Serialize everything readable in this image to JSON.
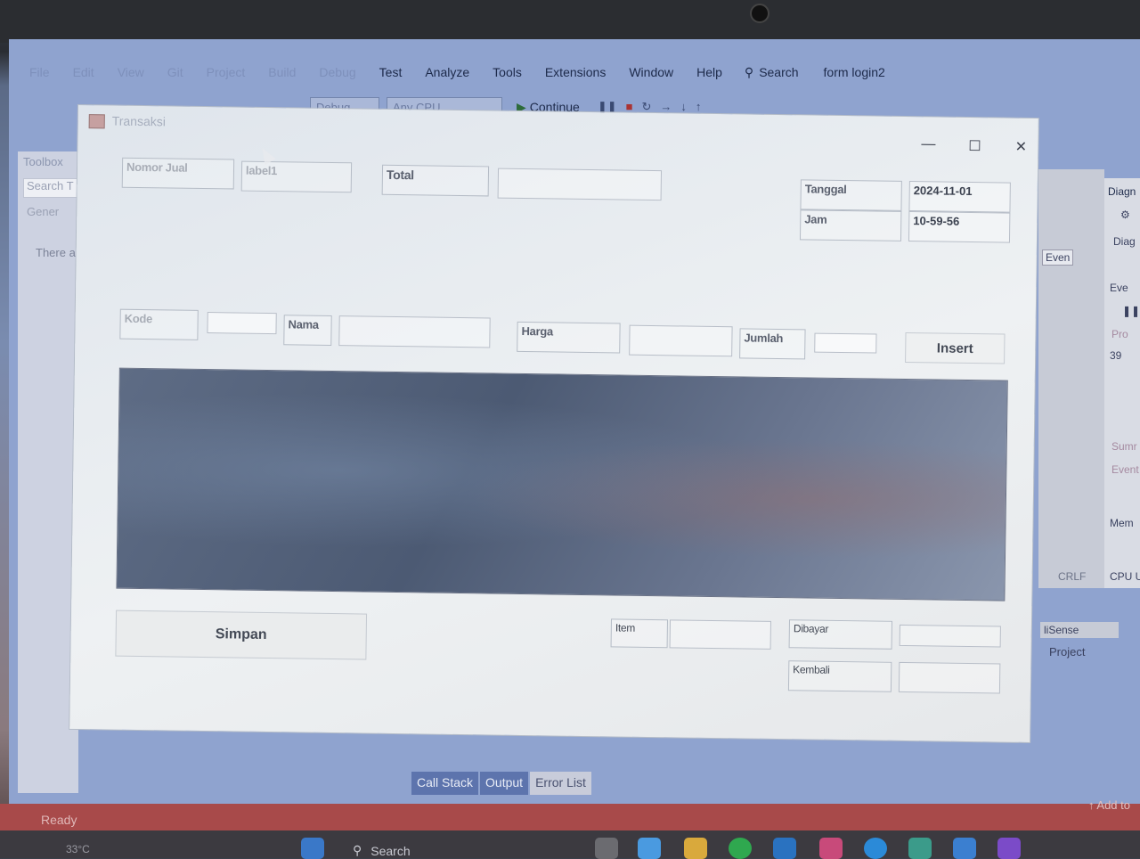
{
  "ide": {
    "menu": [
      "File",
      "Edit",
      "View",
      "Git",
      "Project",
      "Build",
      "Debug",
      "Test",
      "Analyze",
      "Tools",
      "Extensions",
      "Window",
      "Help"
    ],
    "search_label": "Search",
    "project_name": "form login2",
    "config_combo": "Debug",
    "platform_combo": "Any CPU",
    "continue_label": "Continue",
    "toolbox_title": "Toolbox",
    "toolbox_search": "Search T",
    "toolbox_general": "Gener",
    "toolbox_empty": "There a",
    "right_panel": {
      "events_combo": "Even",
      "crlf": "CRLF",
      "isense": "liSense",
      "project": "Project"
    },
    "diag_panel": {
      "title": "Diagn",
      "tab": "Diag",
      "events": "Eve",
      "process": "Pro",
      "value": "39",
      "summary": "Sumr",
      "events2": "Event",
      "memory": "Mem",
      "cpu": "CPU U"
    },
    "bottom_tabs": [
      "Call Stack",
      "Output",
      "Error List"
    ],
    "status": "Ready",
    "add_to": "Add to",
    "taskbar_search": "Search",
    "taskbar_temp": "33°C"
  },
  "dialog": {
    "title": "Transaksi",
    "labels": {
      "nomor_jual": "Nomor Jual",
      "label1": "label1",
      "total": "Total",
      "tanggal": "Tanggal",
      "jam": "Jam",
      "kode": "Kode",
      "nama": "Nama",
      "harga": "Harga",
      "jumlah": "Jumlah",
      "item": "Item",
      "dibayar": "Dibayar",
      "kembali": "Kembali"
    },
    "values": {
      "tanggal": "2024-11-01",
      "jam": "10-59-56",
      "total": "",
      "kode": "",
      "nama": "",
      "harga": "",
      "jumlah": "",
      "item": "",
      "dibayar": "",
      "kembali": ""
    },
    "buttons": {
      "insert": "Insert",
      "simpan": "Simpan"
    }
  }
}
